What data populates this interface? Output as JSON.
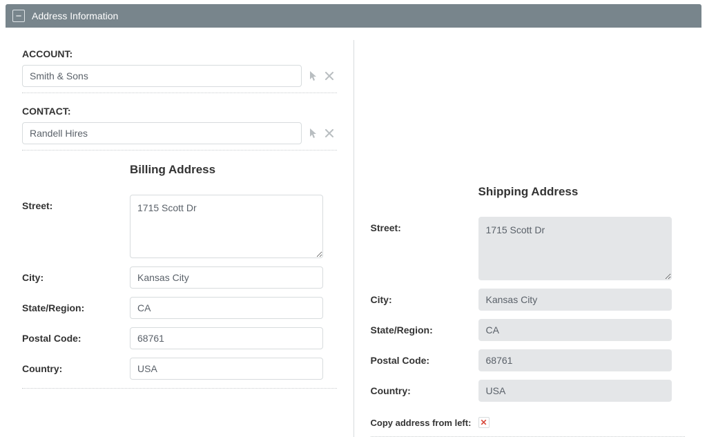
{
  "panel": {
    "title": "Address Information"
  },
  "account": {
    "label": "ACCOUNT:",
    "value": "Smith & Sons"
  },
  "contact": {
    "label": "CONTACT:",
    "value": "Randell Hires"
  },
  "billing": {
    "title": "Billing Address",
    "street_label": "Street:",
    "street": "1715 Scott Dr",
    "city_label": "City:",
    "city": "Kansas City",
    "state_label": "State/Region:",
    "state": "CA",
    "postal_label": "Postal Code:",
    "postal": "68761",
    "country_label": "Country:",
    "country": "USA"
  },
  "shipping": {
    "title": "Shipping Address",
    "street_label": "Street:",
    "street": "1715 Scott Dr",
    "city_label": "City:",
    "city": "Kansas City",
    "state_label": "State/Region:",
    "state": "CA",
    "postal_label": "Postal Code:",
    "postal": "68761",
    "country_label": "Country:",
    "country": "USA",
    "copy_label": "Copy address from left:"
  }
}
